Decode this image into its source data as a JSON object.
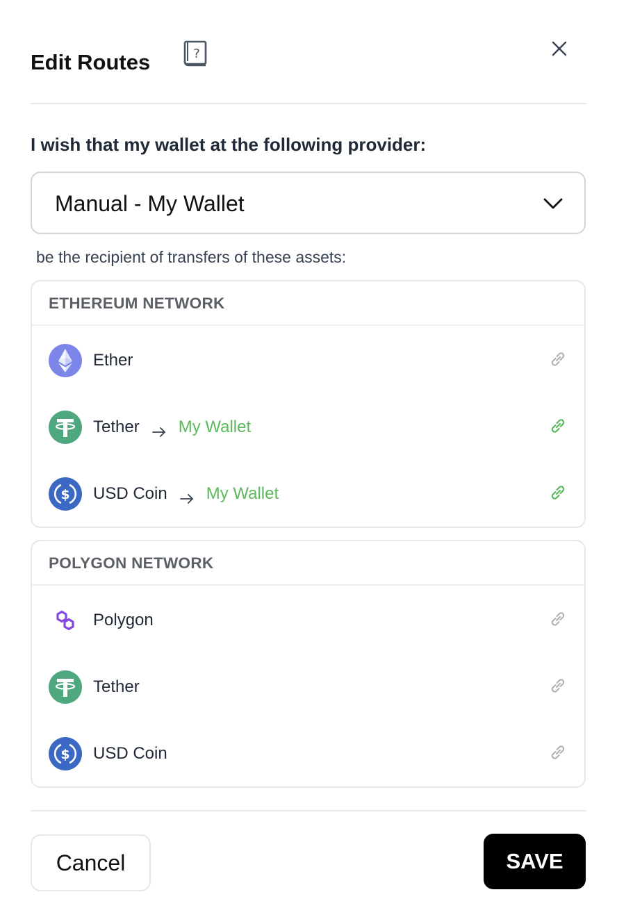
{
  "header": {
    "title": "Edit Routes"
  },
  "prompt": "I wish that my wallet at the following provider:",
  "provider_select": {
    "value": "Manual - My Wallet"
  },
  "subtext": "be the recipient of transfers of these assets:",
  "networks": [
    {
      "title": "ETHEREUM NETWORK",
      "assets": [
        {
          "name": "Ether",
          "icon": "ether-icon",
          "destination": null,
          "linked": false
        },
        {
          "name": "Tether",
          "icon": "tether-icon",
          "destination": "My Wallet",
          "linked": true
        },
        {
          "name": "USD Coin",
          "icon": "usdc-icon",
          "destination": "My Wallet",
          "linked": true
        }
      ]
    },
    {
      "title": "POLYGON NETWORK",
      "assets": [
        {
          "name": "Polygon",
          "icon": "polygon-icon",
          "destination": null,
          "linked": false
        },
        {
          "name": "Tether",
          "icon": "tether-icon",
          "destination": null,
          "linked": false
        },
        {
          "name": "USD Coin",
          "icon": "usdc-icon",
          "destination": null,
          "linked": false
        }
      ]
    }
  ],
  "footer": {
    "cancel_label": "Cancel",
    "save_label": "SAVE"
  },
  "colors": {
    "accent_green": "#5cb85c",
    "link_inactive": "#b0b3b8",
    "ether_bg": "#7b86e8",
    "tether_bg": "#4ea77f",
    "usdc_bg": "#3b68c2",
    "polygon": "#8247e5",
    "save_bg": "#000000"
  }
}
